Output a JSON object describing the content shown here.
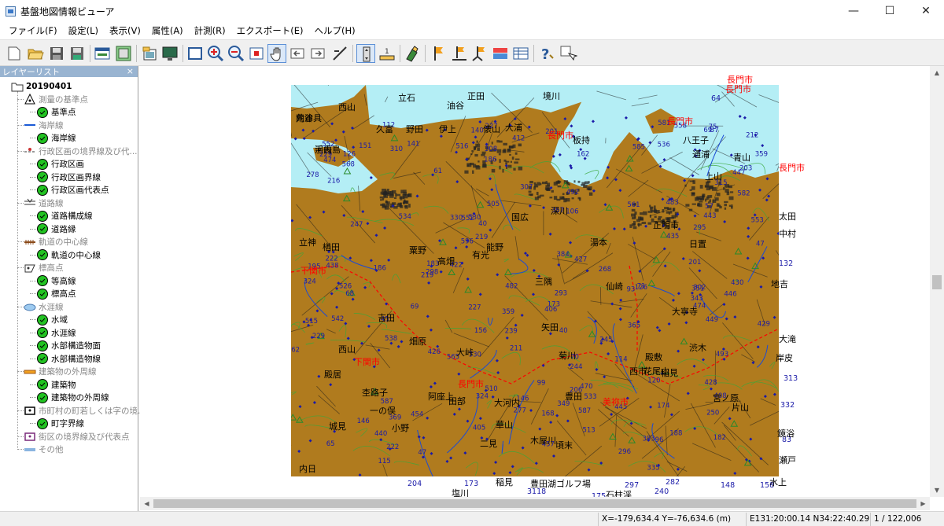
{
  "window": {
    "title": "基盤地図情報ビューア",
    "minimize": "—",
    "maximize": "☐",
    "close": "✕"
  },
  "menu": [
    "ファイル(F)",
    "設定(L)",
    "表示(V)",
    "属性(A)",
    "計測(R)",
    "エクスポート(E)",
    "ヘルプ(H)"
  ],
  "toolbar_icons": [
    "new-icon",
    "open-folder-icon",
    "save-icon",
    "save-as-icon",
    "layer-window-icon",
    "map-frame-icon",
    "export-image-icon",
    "monitor-icon",
    "full-extent-icon",
    "zoom-in-icon",
    "zoom-out-icon",
    "zoom-rect-icon",
    "pan-hand-icon",
    "previous-view-icon",
    "next-view-icon",
    "measure-line-icon",
    "vertical-toggle-icon",
    "scale-icon",
    "highlight-icon",
    "flag-icon",
    "flag-point-icon",
    "flag-area-icon",
    "layer-color-icon",
    "attribute-table-icon",
    "help-icon",
    "settings-cursor-icon"
  ],
  "layer_panel": {
    "title": "レイヤーリスト",
    "close": "×",
    "root": "20190401",
    "groups": [
      {
        "label": "測量の基準点",
        "icon": "triangle-point-icon",
        "children": [
          "基準点"
        ]
      },
      {
        "label": "海岸線",
        "icon": "line-blue-icon",
        "children": [
          "海岸線"
        ]
      },
      {
        "label": "行政区画の境界線及び代...",
        "icon": "boundary-dot-icon",
        "children": [
          "行政区画",
          "行政区画界線",
          "行政区画代表点"
        ]
      },
      {
        "label": "道路線",
        "icon": "road-icon",
        "children": [
          "道路構成線",
          "道路縁"
        ]
      },
      {
        "label": "軌道の中心線",
        "icon": "rail-icon",
        "children": [
          "軌道の中心線"
        ]
      },
      {
        "label": "標高点",
        "icon": "elevation-point-icon",
        "children": [
          "等高線",
          "標高点"
        ]
      },
      {
        "label": "水涯線",
        "icon": "water-icon",
        "children": [
          "水域",
          "水涯線",
          "水部構造物面",
          "水部構造物線"
        ]
      },
      {
        "label": "建築物の外周線",
        "icon": "building-icon",
        "children": [
          "建築物",
          "建築物の外周線"
        ]
      },
      {
        "label": "市町村の町若しくは字の境...",
        "icon": "town-boundary-icon",
        "children": [
          "町字界線"
        ]
      },
      {
        "label": "街区の境界線及び代表点",
        "icon": "block-boundary-icon",
        "children": []
      },
      {
        "label": "その他",
        "icon": "other-icon",
        "children": []
      }
    ]
  },
  "map": {
    "colors": {
      "land": "#b07b1e",
      "sea": "#b4eef5",
      "boundary": "#ff0000",
      "elevation": "#1a1aa8"
    },
    "city_labels_outside": [
      {
        "text": "長門市"
      },
      {
        "text": "長門市"
      },
      {
        "text": "長門市"
      }
    ],
    "numbers_outside": [
      {
        "text": "64"
      },
      {
        "text": "87"
      },
      {
        "text": "132"
      },
      {
        "text": "313"
      },
      {
        "text": "332"
      },
      {
        "text": "83"
      },
      {
        "text": "204"
      },
      {
        "text": "173"
      },
      {
        "text": "297"
      },
      {
        "text": "282"
      },
      {
        "text": "148"
      },
      {
        "text": "158"
      },
      {
        "text": "240"
      },
      {
        "text": "175"
      },
      {
        "text": "3118"
      }
    ],
    "places_outside": [
      {
        "text": "塩川"
      },
      {
        "text": "稲見"
      },
      {
        "text": "豊田湖ゴルフ場"
      },
      {
        "text": "石柱渓"
      },
      {
        "text": "水上"
      },
      {
        "text": "中村"
      },
      {
        "text": "地吉"
      },
      {
        "text": "大滝"
      },
      {
        "text": "岸皮"
      },
      {
        "text": "鏡浴"
      },
      {
        "text": "瀬戸"
      },
      {
        "text": "太田"
      }
    ],
    "places": [
      {
        "text": "向津具"
      },
      {
        "text": "手長島"
      },
      {
        "text": "西山"
      },
      {
        "text": "立石"
      },
      {
        "text": "正田"
      },
      {
        "text": "油谷"
      },
      {
        "text": "境川"
      },
      {
        "text": "大浦"
      },
      {
        "text": "久富"
      },
      {
        "text": "野田"
      },
      {
        "text": "伊上"
      },
      {
        "text": "俵山"
      },
      {
        "text": "板持"
      },
      {
        "text": "八王子"
      },
      {
        "text": "通浦"
      },
      {
        "text": "青山"
      },
      {
        "text": "上山"
      },
      {
        "text": "立神"
      },
      {
        "text": "楢田"
      },
      {
        "text": "粟野"
      },
      {
        "text": "高畑"
      },
      {
        "text": "有光"
      },
      {
        "text": "能野"
      },
      {
        "text": "国広"
      },
      {
        "text": "正明市"
      },
      {
        "text": "日置"
      },
      {
        "text": "深川"
      },
      {
        "text": "三隅"
      },
      {
        "text": "畑原"
      },
      {
        "text": "大峠"
      },
      {
        "text": "吉田"
      },
      {
        "text": "殿居"
      },
      {
        "text": "杢路子"
      },
      {
        "text": "阿座上"
      },
      {
        "text": "田部"
      },
      {
        "text": "大河内"
      },
      {
        "text": "豊田"
      },
      {
        "text": "西市"
      },
      {
        "text": "殿敷"
      },
      {
        "text": "矢田"
      },
      {
        "text": "稲見"
      },
      {
        "text": "一の俣"
      },
      {
        "text": "華山"
      },
      {
        "text": "木屋川"
      },
      {
        "text": "頃末"
      },
      {
        "text": "二見"
      },
      {
        "text": "城見"
      },
      {
        "text": "小野"
      },
      {
        "text": "内日"
      },
      {
        "text": "菊川"
      },
      {
        "text": "西山"
      },
      {
        "text": "大寧寺"
      },
      {
        "text": "湯本"
      },
      {
        "text": "仙崎"
      },
      {
        "text": "渋木"
      },
      {
        "text": "宮ノ原"
      },
      {
        "text": "片山"
      },
      {
        "text": "花尾山"
      },
      {
        "text": "荒谷"
      },
      {
        "text": "河内"
      }
    ],
    "cities": [
      {
        "text": "下関市"
      },
      {
        "text": "長門市"
      },
      {
        "text": "長門市"
      },
      {
        "text": "長門市"
      },
      {
        "text": "下関市"
      },
      {
        "text": "美祢市"
      }
    ]
  },
  "status": {
    "coords": "X=-179,634.4 Y=-76,634.6 (m)",
    "latlon": "E131:20:00.14 N34:22:40.29",
    "scale": "1 / 122,006"
  }
}
